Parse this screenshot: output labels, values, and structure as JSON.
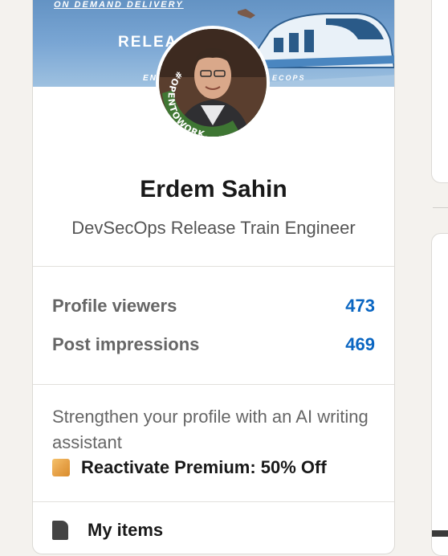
{
  "profile_card": {
    "banner": {
      "top_text": "ON DEMAND DELIVERY",
      "title_text": "RELEA",
      "left_sub": "EN",
      "right_sub": "ECOPS"
    },
    "avatar_badge": "#OPENTOWORK",
    "name": "Erdem Sahin",
    "headline": "DevSecOps Release Train Engineer",
    "stats": [
      {
        "label": "Profile viewers",
        "value": "473"
      },
      {
        "label": "Post impressions",
        "value": "469"
      }
    ],
    "promo": {
      "text": "Strengthen your profile with an AI writing assistant",
      "premium_label": "Reactivate Premium: 50% Off",
      "premium_icon": "premium-icon"
    },
    "my_items": {
      "label": "My items",
      "icon": "bookmark-icon"
    }
  },
  "colors": {
    "background": "#f4f2ee",
    "card": "#ffffff",
    "link_blue": "#0a66c2",
    "open_to_work_green": "#3f7a34"
  }
}
